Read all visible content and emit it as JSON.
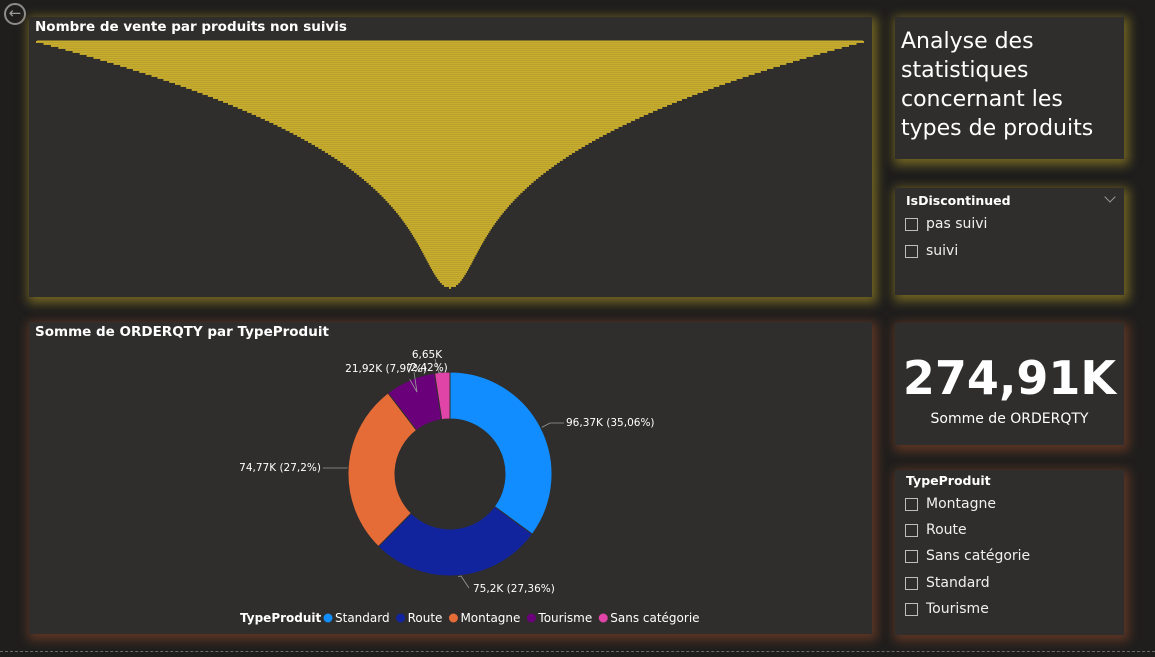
{
  "nav": {
    "back_icon": "arrow-left-icon"
  },
  "funnel": {
    "title": "Nombre de vente par produits non suivis",
    "color": "#c9ad2c",
    "chart_data": {
      "type": "bar",
      "orientation": "horizontal-centered",
      "series_color": "#c9ad2c"
    }
  },
  "donut": {
    "title": "Somme de ORDERQTY par TypeProduit",
    "legend_title": "TypeProduit",
    "chart_data": {
      "type": "pie",
      "variant": "donut",
      "categories": [
        "Standard",
        "Route",
        "Montagne",
        "Tourisme",
        "Sans catégorie"
      ],
      "values": [
        96.37,
        75.2,
        74.77,
        21.92,
        6.65
      ],
      "percents": [
        35.06,
        27.36,
        27.2,
        7.97,
        2.42
      ],
      "colors": [
        "#118dff",
        "#12239e",
        "#e66c37",
        "#6b007b",
        "#e044a7"
      ],
      "data_labels": [
        [
          "96,37K (35,06%)"
        ],
        [
          "75,2K (27,36%)"
        ],
        [
          "74,77K (27,2%)"
        ],
        [
          "21,92K (7,97%)"
        ],
        [
          "6,65K",
          "(2,42%)"
        ]
      ],
      "legend_position": "bottom"
    }
  },
  "title_card": {
    "lines": [
      "Analyse des",
      "statistiques",
      "concernant les",
      "types de produits"
    ]
  },
  "slicer_discontinued": {
    "title": "IsDiscontinued",
    "items": [
      "pas suivi",
      "suivi"
    ],
    "dropdown_icon": "chevron-down-icon"
  },
  "kpi": {
    "value": "274,91K",
    "label": "Somme de ORDERQTY"
  },
  "slicer_type": {
    "title": "TypeProduit",
    "items": [
      "Montagne",
      "Route",
      "Sans catégorie",
      "Standard",
      "Tourisme"
    ]
  }
}
